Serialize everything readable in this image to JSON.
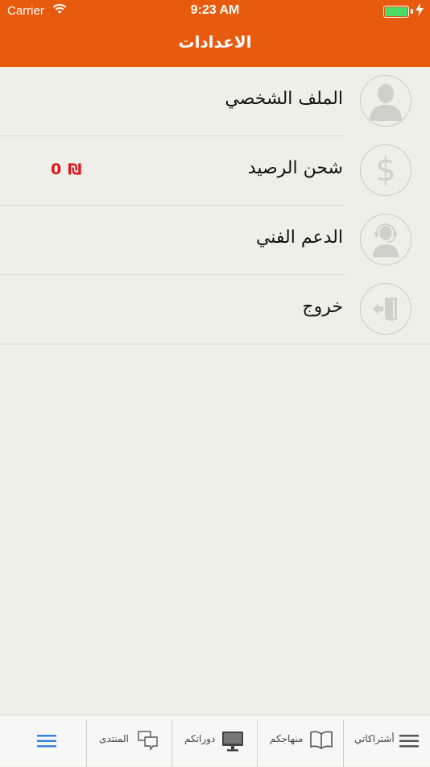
{
  "status_bar": {
    "carrier": "Carrier",
    "time": "9:23 AM",
    "battery_color": "#4cd964"
  },
  "header": {
    "title": "الاعدادات",
    "background": "#e85a0e"
  },
  "settings": {
    "items": [
      {
        "label": "الملف الشخصي",
        "icon": "profile-icon"
      },
      {
        "label": "شحن الرصيد",
        "icon": "dollar-icon",
        "value": "0",
        "currency": "₪"
      },
      {
        "label": "الدعم الفني",
        "icon": "support-agent-icon"
      },
      {
        "label": "خروج",
        "icon": "logout-icon"
      }
    ],
    "value_color": "#e0141a"
  },
  "tabbar": {
    "tabs": [
      {
        "label": "",
        "icon": "menu-icon",
        "active": true
      },
      {
        "label": "المنتدى",
        "icon": "forum-icon"
      },
      {
        "label": "دوراتكم",
        "icon": "monitor-icon"
      },
      {
        "label": "منهاجكم",
        "icon": "book-icon"
      },
      {
        "label": "أشتراكاتي",
        "icon": "list-icon"
      }
    ],
    "active_color": "#3b82e6"
  }
}
